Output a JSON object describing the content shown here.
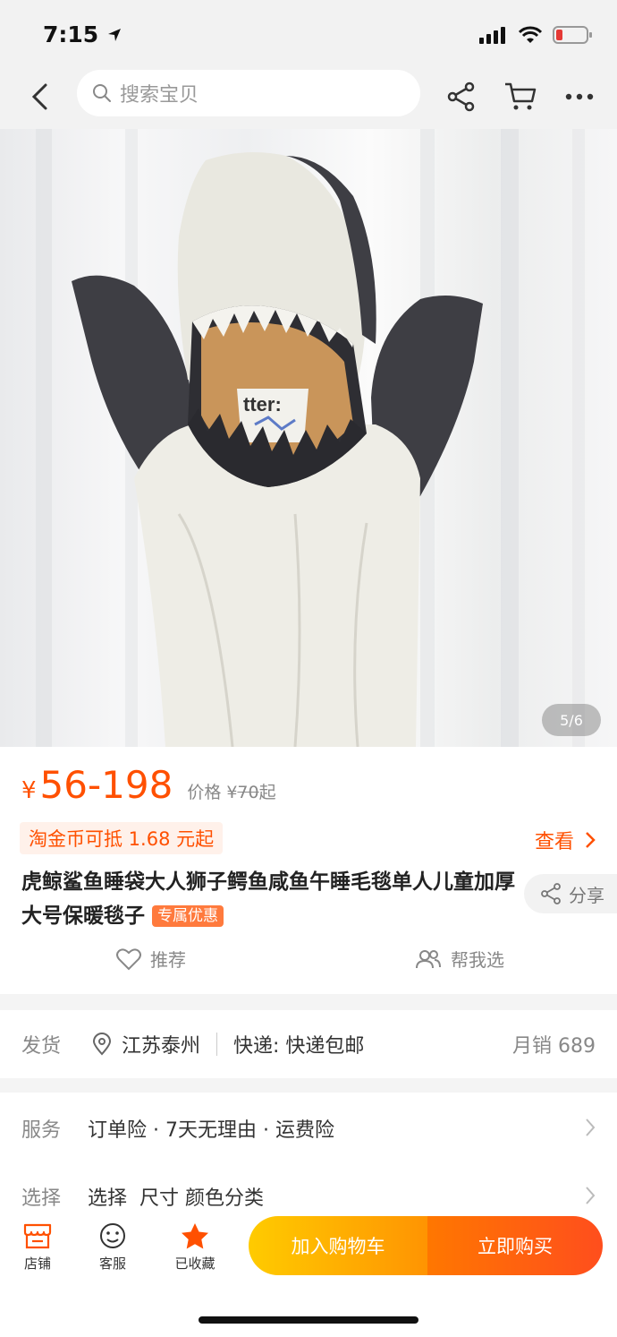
{
  "status_bar": {
    "time": "7:15"
  },
  "nav": {
    "search_placeholder": "搜索宝贝"
  },
  "gallery": {
    "counter": "5/6"
  },
  "price": {
    "currency": "¥",
    "range": "56-198",
    "label": "价格",
    "original_currency": "¥",
    "original": "70",
    "original_suffix": "起"
  },
  "promo": {
    "coin_text": "淘金币可抵 1.68 元起",
    "view_label": "查看"
  },
  "product": {
    "title": "虎鲸鲨鱼睡袋大人狮子鳄鱼咸鱼午睡毛毯单人儿童加厚大号保暖毯子",
    "tag": "专属优惠",
    "share_label": "分享"
  },
  "actions": {
    "recommend": "推荐",
    "help_choose": "帮我选"
  },
  "shipping": {
    "label": "发货",
    "location": "江苏泰州",
    "express": "快递: 快递包邮",
    "sales": "月销 689"
  },
  "service": {
    "label": "服务",
    "value": "订单险 · 7天无理由 · 运费险"
  },
  "select": {
    "label": "选择",
    "value": "选择  尺寸 颜色分类"
  },
  "bottom_bar": {
    "shop": "店铺",
    "service": "客服",
    "favorited": "已收藏",
    "add_cart": "加入购物车",
    "buy_now": "立即购买"
  },
  "colors": {
    "accent": "#ff5000",
    "cart_button": "#ffb300",
    "buy_button": "#ff5a1a"
  },
  "icons": [
    "back-icon",
    "search-icon",
    "share-icon",
    "cart-icon",
    "more-icon",
    "heart-icon",
    "people-icon",
    "location-icon",
    "chevron-right-icon",
    "shop-icon",
    "chat-icon",
    "star-icon"
  ]
}
